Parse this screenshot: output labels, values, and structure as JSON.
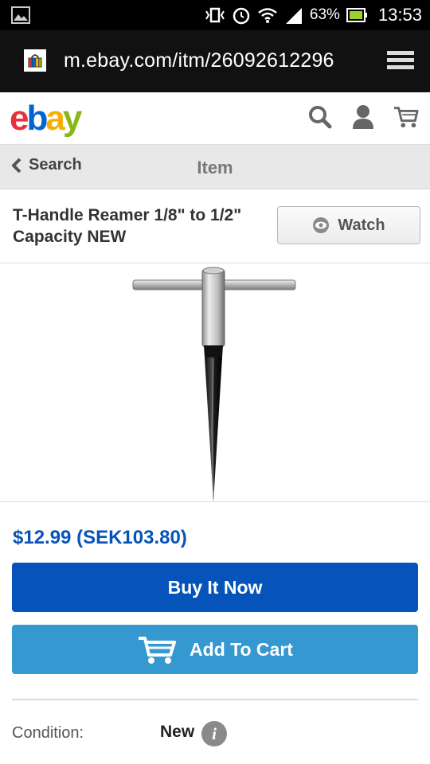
{
  "status_bar": {
    "battery_percent": "63%",
    "time": "13:53"
  },
  "browser": {
    "url": "m.ebay.com/itm/26092612296"
  },
  "header": {
    "logo_letters": [
      "e",
      "b",
      "a",
      "y"
    ],
    "icons": [
      "search-icon",
      "account-icon",
      "cart-icon"
    ]
  },
  "nav": {
    "back_label": "Search",
    "title": "Item"
  },
  "item": {
    "title": "T-Handle Reamer 1/8\" to 1/2\" Capacity NEW",
    "watch_label": "Watch",
    "price": "$12.99 (SEK103.80)",
    "buy_now_label": "Buy It Now",
    "add_to_cart_label": "Add To Cart",
    "condition_label": "Condition:",
    "condition_value": "New",
    "info_icon_glyph": "i"
  },
  "colors": {
    "buy_now": "#0654ba",
    "add_to_cart": "#3598d1",
    "price": "#0654ba"
  }
}
